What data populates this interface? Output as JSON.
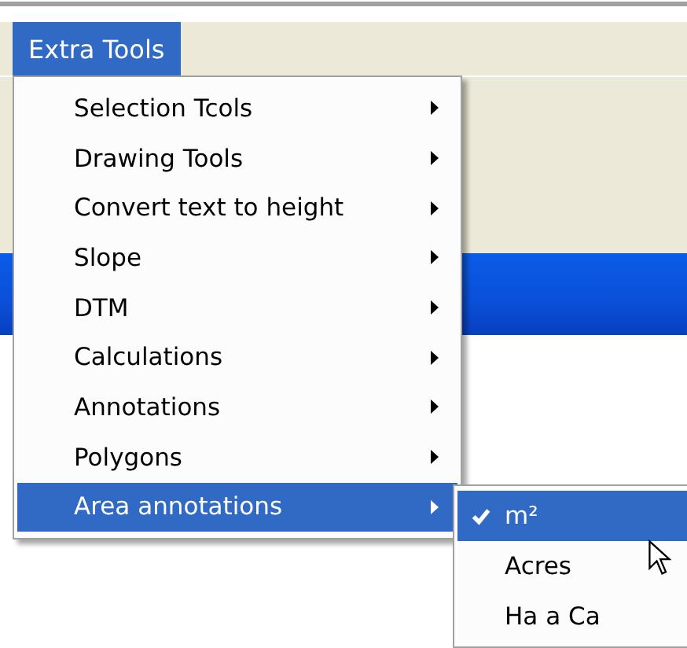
{
  "menu_bar": [
    {
      "label": "Extra Tools",
      "selected": true
    }
  ],
  "menu": [
    {
      "label": "Selection Tcols",
      "selected": false
    },
    {
      "label": "Drawing Tools",
      "selected": false
    },
    {
      "label": "Convert text to height",
      "selected": false
    },
    {
      "label": "Slope",
      "selected": false
    },
    {
      "label": "DTM",
      "selected": false
    },
    {
      "label": "Calculations",
      "selected": false
    },
    {
      "label": "Annotations",
      "selected": false
    },
    {
      "label": "Polygons",
      "selected": false
    },
    {
      "label": "Area annotations",
      "selected": true
    }
  ],
  "submenu": [
    {
      "label": "m²",
      "checked": true,
      "selected": true
    },
    {
      "label": "Acres",
      "checked": false,
      "selected": false
    },
    {
      "label": "Ha a Ca",
      "checked": false,
      "selected": false
    }
  ]
}
